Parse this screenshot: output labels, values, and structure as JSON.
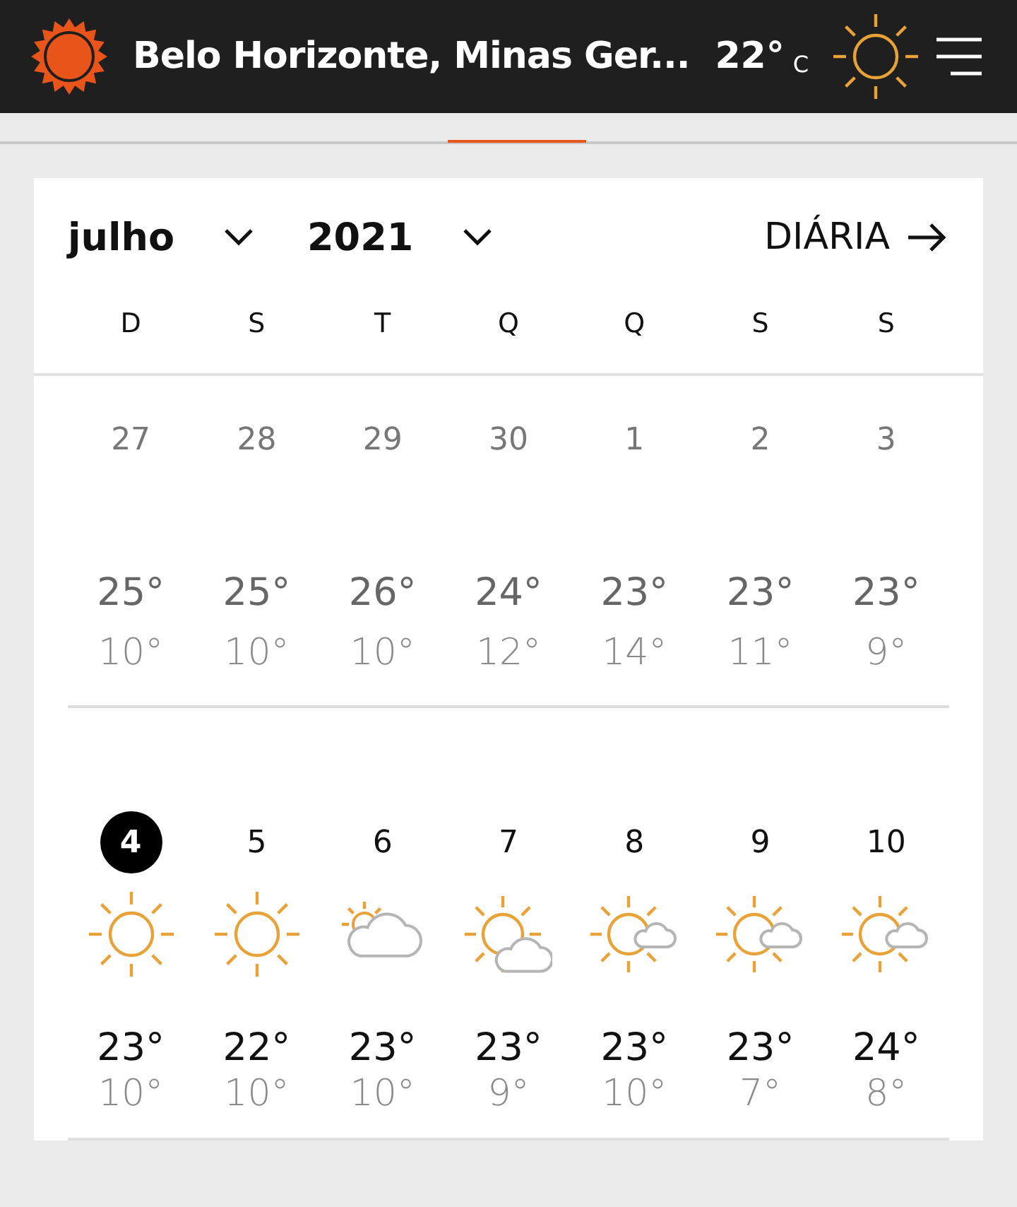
{
  "header": {
    "location": "Belo Horizonte, Minas Ger...",
    "temperature": "22°",
    "unit": "C"
  },
  "calendar": {
    "month": "julho",
    "year": "2021",
    "view": "DIÁRIA",
    "weekdays": [
      "D",
      "S",
      "T",
      "Q",
      "Q",
      "S",
      "S"
    ],
    "weeks": [
      {
        "days": [
          {
            "kind": "plain",
            "date": "27",
            "high": "25°",
            "low": "10°",
            "past": true,
            "today": false
          },
          {
            "kind": "plain",
            "date": "28",
            "high": "25°",
            "low": "10°",
            "past": true,
            "today": false
          },
          {
            "kind": "plain",
            "date": "29",
            "high": "26°",
            "low": "10°",
            "past": true,
            "today": false
          },
          {
            "kind": "plain",
            "date": "30",
            "high": "24°",
            "low": "12°",
            "past": true,
            "today": false
          },
          {
            "kind": "plain",
            "date": "1",
            "high": "23°",
            "low": "14°",
            "past": true,
            "today": false
          },
          {
            "kind": "plain",
            "date": "2",
            "high": "23°",
            "low": "11°",
            "past": true,
            "today": false
          },
          {
            "kind": "plain",
            "date": "3",
            "high": "23°",
            "low": "9°",
            "past": true,
            "today": false
          }
        ]
      },
      {
        "days": [
          {
            "kind": "sunny",
            "date": "4",
            "high": "23°",
            "low": "10°",
            "past": false,
            "today": true
          },
          {
            "kind": "sunny",
            "date": "5",
            "high": "22°",
            "low": "10°",
            "past": false,
            "today": false
          },
          {
            "kind": "cloudy",
            "date": "6",
            "high": "23°",
            "low": "10°",
            "past": false,
            "today": false
          },
          {
            "kind": "partly",
            "date": "7",
            "high": "23°",
            "low": "9°",
            "past": false,
            "today": false
          },
          {
            "kind": "fair",
            "date": "8",
            "high": "23°",
            "low": "10°",
            "past": false,
            "today": false
          },
          {
            "kind": "fair",
            "date": "9",
            "high": "23°",
            "low": "7°",
            "past": false,
            "today": false
          },
          {
            "kind": "fair",
            "date": "10",
            "high": "24°",
            "low": "8°",
            "past": false,
            "today": false
          }
        ]
      }
    ]
  }
}
